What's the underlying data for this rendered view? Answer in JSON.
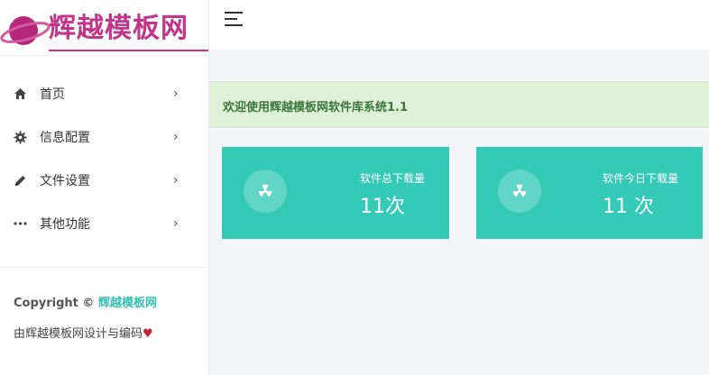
{
  "logo": {
    "text": "辉越模板网"
  },
  "sidebar": {
    "items": [
      {
        "label": "首页",
        "icon": "home-icon"
      },
      {
        "label": "信息配置",
        "icon": "gear-icon"
      },
      {
        "label": "文件设置",
        "icon": "pencil-icon"
      },
      {
        "label": "其他功能",
        "icon": "more-icon"
      }
    ],
    "copyright_prefix": "Copyright ©",
    "copyright_brand": "辉越模板网",
    "credits": "由辉越模板网设计与编码"
  },
  "alert": {
    "text": "欢迎使用辉越模板网软件库系统1.1"
  },
  "stats": [
    {
      "title": "软件总下载量",
      "value": "11次"
    },
    {
      "title": "软件今日下载量",
      "value": "11 次"
    }
  ],
  "colors": {
    "card": "#35c9b8",
    "accent": "#35c0b4",
    "logo": "#c0368a",
    "alert_bg": "#dff0d8",
    "alert_text": "#3c763d"
  }
}
